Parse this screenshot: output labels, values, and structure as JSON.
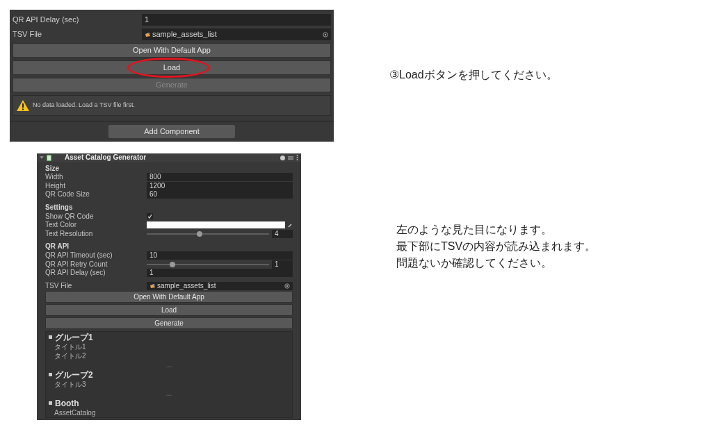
{
  "step_note": "③Loadボタンを押してください。",
  "before_panel": {
    "fields": [
      {
        "kind": "number",
        "label": "QR API Delay (sec)",
        "value": "1"
      },
      {
        "kind": "object",
        "label": "TSV File",
        "value": "sample_assets_list"
      }
    ],
    "buttons": [
      {
        "label": "Open With Default App",
        "disabled": false,
        "highlighted": false
      },
      {
        "label": "Load",
        "disabled": false,
        "highlighted": true
      },
      {
        "label": "Generate",
        "disabled": true,
        "highlighted": false
      }
    ],
    "warning": "No data loaded. Load a TSV file first.",
    "add_component": "Add Component"
  },
  "after_panel": {
    "title": "Asset Catalog Generator",
    "sections": [
      {
        "heading": "Size",
        "fields": [
          {
            "kind": "number",
            "label": "Width",
            "value": "800"
          },
          {
            "kind": "number",
            "label": "Height",
            "value": "1200"
          },
          {
            "kind": "number",
            "label": "QR Code Size",
            "value": "60"
          }
        ]
      },
      {
        "heading": "Settings",
        "fields": [
          {
            "kind": "toggle",
            "label": "Show QR Code",
            "checked": true
          },
          {
            "kind": "color",
            "label": "Text Color",
            "color": "#ffffff"
          },
          {
            "kind": "slider",
            "label": "Text Resolution",
            "level": 0.43,
            "value": "4"
          }
        ]
      },
      {
        "heading": "QR API",
        "fields": [
          {
            "kind": "number",
            "label": "QR API Timeout (sec)",
            "value": "10"
          },
          {
            "kind": "slider",
            "label": "QR API Retry Count",
            "level": 0.21,
            "value": "1"
          },
          {
            "kind": "number",
            "label": "QR API Delay (sec)",
            "value": "1"
          }
        ]
      }
    ],
    "file_field": {
      "kind": "object",
      "label": "TSV File",
      "value": "sample_assets_list"
    },
    "buttons": [
      {
        "label": "Open With Default App",
        "disabled": false,
        "highlighted": false
      },
      {
        "label": "Load",
        "disabled": false,
        "highlighted": false
      },
      {
        "label": "Generate",
        "disabled": false,
        "highlighted": false
      }
    ],
    "groups": [
      {
        "name": "グループ1",
        "items": [
          "タイトル1",
          "タイトル2"
        ],
        "separator": "..."
      },
      {
        "name": "グループ2",
        "items": [
          "タイトル3"
        ],
        "separator": "..."
      },
      {
        "name": "Booth",
        "items": [
          "AssetCatalog"
        ]
      }
    ]
  },
  "result_note": [
    "左のような見た目になります。",
    "最下部にTSVの内容が読み込まれます。",
    "問題ないか確認してください。"
  ]
}
